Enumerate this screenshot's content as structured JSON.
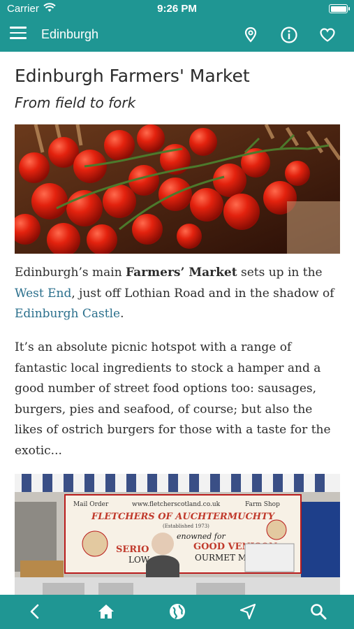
{
  "status": {
    "carrier": "Carrier",
    "time": "9:26 PM"
  },
  "nav": {
    "title": "Edinburgh"
  },
  "article": {
    "title": "Edinburgh Farmers' Market",
    "subtitle": "From field to fork",
    "para1": {
      "t1": "Edinburgh’s main ",
      "b1": "Farmers’ Market",
      "t2": " sets up in the ",
      "link1": "West End",
      "t3": ", just off Lothian Road and in the shadow of ",
      "link2": "Edinburgh Castle",
      "t4": "."
    },
    "para2": "It’s an absolute picnic hotspot with a range of fantastic local ingredients to stock a hamper and a good number of street food options too: sausages, burgers, pies and seafood, of course; but also the likes of ostrich burgers for those with a taste for the exotic...",
    "sign": {
      "mail_order": "Mail Order",
      "url": "www.fletcherscotland.co.uk",
      "farm_shop": "Farm Shop",
      "name": "FLETCHERS OF AUCHTERMUCHTY",
      "established": "(Established 1973)",
      "renowned": "enowned for",
      "line1a": "SERIO",
      "line1b": "GOOD VENISON",
      "line2a": "LOW",
      "line2b": "OURMET MEAT"
    }
  },
  "colors": {
    "teal": "#1f9693",
    "link": "#2a6f8c",
    "text": "#2c2c2c"
  }
}
